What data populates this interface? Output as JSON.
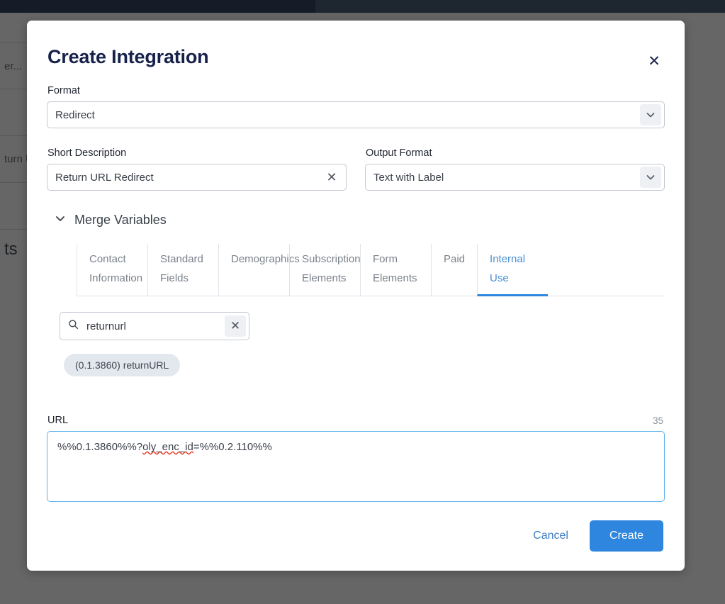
{
  "background": {
    "rows": [
      "er...",
      "",
      "turn U",
      ""
    ],
    "heading": "ts"
  },
  "modal": {
    "title": "Create Integration",
    "close_icon": "close-icon",
    "format": {
      "label": "Format",
      "value": "Redirect",
      "arrow_icon": "chevron-down-icon"
    },
    "short_description": {
      "label": "Short Description",
      "value": "Return URL Redirect",
      "clear_icon": "close-icon"
    },
    "output_format": {
      "label": "Output Format",
      "value": "Text with Label",
      "arrow_icon": "chevron-down-icon"
    },
    "merge_variables": {
      "label": "Merge Variables",
      "chevron_icon": "chevron-down-icon",
      "tabs": [
        {
          "label": "Contact Information",
          "active": false
        },
        {
          "label": "Standard Fields",
          "active": false
        },
        {
          "label": "Demographics",
          "active": false
        },
        {
          "label": "Subscription Elements",
          "active": false
        },
        {
          "label": "Form Elements",
          "active": false
        },
        {
          "label": "Paid",
          "active": false
        },
        {
          "label": "Internal Use",
          "active": true
        }
      ],
      "search": {
        "value": "returnurl",
        "search_icon": "search-icon",
        "clear_icon": "close-icon"
      },
      "results": [
        {
          "label": "(0.1.3860) returnURL"
        }
      ]
    },
    "url": {
      "label": "URL",
      "char_count": "35",
      "value_prefix": "%%0.1.3860%%?",
      "value_misspelled": "oly_enc_id",
      "value_suffix": "=%%0.2.110%%"
    },
    "footer": {
      "cancel_label": "Cancel",
      "create_label": "Create"
    }
  },
  "colors": {
    "accent": "#2e86de",
    "title": "#17224b",
    "focus_border": "#5cb3ef",
    "chip_bg": "#e3e8ef",
    "topbar": "#151c27"
  }
}
